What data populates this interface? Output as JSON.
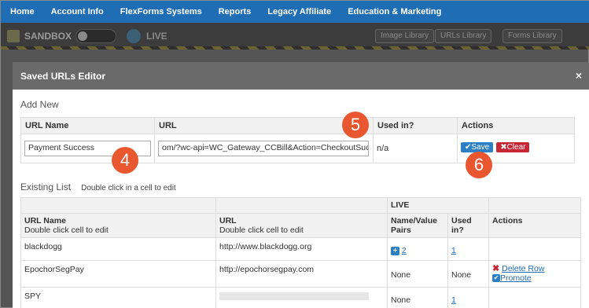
{
  "nav": [
    "Home",
    "Account Info",
    "FlexForms Systems",
    "Reports",
    "Legacy Affiliate",
    "Education & Marketing"
  ],
  "sandbox": {
    "label": "SANDBOX",
    "live_label": "LIVE",
    "image_library": "Image Library",
    "urls_library": "URLs Library",
    "forms_library": "Forms Library"
  },
  "modal": {
    "title": "Saved URLs Editor",
    "close": "×"
  },
  "add_new": {
    "title": "Add New",
    "headers": [
      "URL Name",
      "URL",
      "Used in?",
      "Actions"
    ],
    "name_value": "Payment Success",
    "url_value": "om/?wc-api=WC_Gateway_CCBill&Action=CheckoutSuccess",
    "used_in": "n/a",
    "save_label": "Save",
    "clear_label": "Clear"
  },
  "existing": {
    "title": "Existing List",
    "hint": "Double click in a cell to edit",
    "live_header": "LIVE",
    "headers": {
      "name": "URL Name",
      "name_sub": "Double click cell to edit",
      "url": "URL",
      "url_sub": "Double click cell to edit",
      "pairs": "Name/Value Pairs",
      "used_in": "Used in?",
      "actions": "Actions"
    },
    "rows": [
      {
        "name": "blackdogg",
        "url": "http://www.blackdogg.org",
        "pairs": "2",
        "used_in": "1"
      },
      {
        "name": "EpochorSegPay",
        "url": "http://epochorsegpay.com",
        "pairs": "None",
        "used_in": "None",
        "delete": "Delete Row",
        "promote": "Promote"
      },
      {
        "name": "SPY",
        "url": "",
        "pairs": "None",
        "used_in": "1"
      }
    ]
  },
  "callouts": [
    "4",
    "5",
    "6"
  ],
  "colors": {
    "nav_bg": "#1f6db5",
    "save": "#2d7fc3",
    "clear": "#c72735",
    "callout": "#e8572f"
  }
}
